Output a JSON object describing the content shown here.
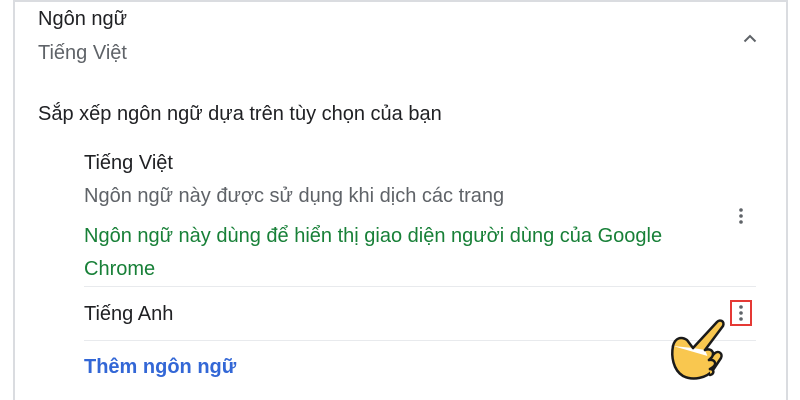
{
  "language_section": {
    "title": "Ngôn ngữ",
    "current_value": "Tiếng Việt",
    "collapse_icon": "chevron-up-icon"
  },
  "ordering": {
    "heading": "Sắp xếp ngôn ngữ dựa trên tùy chọn của bạn"
  },
  "languages": [
    {
      "name": "Tiếng Việt",
      "description": "Ngôn ngữ này được sử dụng khi dịch các trang",
      "ui_note": "Ngôn ngữ này dùng để hiển thị giao diện người dùng của Google Chrome",
      "menu_icon": "more-vert-icon"
    },
    {
      "name": "Tiếng Anh",
      "menu_icon": "more-vert-icon",
      "menu_highlighted": true
    }
  ],
  "add_language_label": "Thêm ngôn ngữ",
  "annotation": {
    "pointer_icon": "pointing-hand-icon",
    "highlight_color": "#e53935"
  },
  "colors": {
    "primary_text": "#202124",
    "secondary_text": "#5f6368",
    "green_note": "#188038",
    "link_blue": "#3367d6"
  }
}
